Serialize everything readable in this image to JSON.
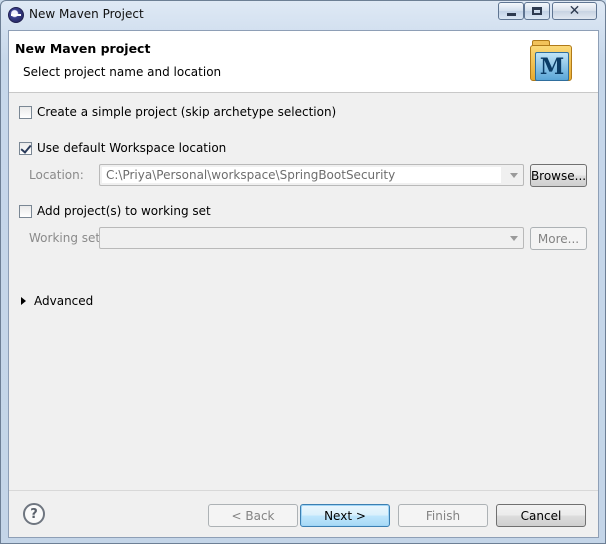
{
  "window": {
    "title": "New Maven Project",
    "controls": {
      "minimize": "—",
      "maximize": "□",
      "close": "✕"
    }
  },
  "header": {
    "title": "New Maven project",
    "description": "Select project name and location",
    "logo_letter": "M",
    "logo_icon": "maven-icon"
  },
  "options": {
    "simple_project": {
      "label": "Create a simple project (skip archetype selection)",
      "checked": false
    },
    "default_workspace": {
      "label": "Use default Workspace location",
      "checked": true
    },
    "location": {
      "label": "Location:",
      "value": "C:\\Priya\\Personal\\workspace\\SpringBootSecurity",
      "browse_label": "Browse..."
    },
    "working_set_checkbox": {
      "label": "Add project(s) to working set",
      "checked": false
    },
    "working_set": {
      "label": "Working set:",
      "value": "",
      "more_label": "More..."
    },
    "advanced": {
      "label": "Advanced",
      "expanded": false
    }
  },
  "footer": {
    "help_label": "?",
    "back_label": "< Back",
    "next_label": "Next >",
    "finish_label": "Finish",
    "cancel_label": "Cancel"
  },
  "colors": {
    "title_bar": "#c6d7ea",
    "dialog_bg": "#f0f0f0",
    "header_bg": "#ffffff",
    "default_button": "#bee6fd"
  }
}
